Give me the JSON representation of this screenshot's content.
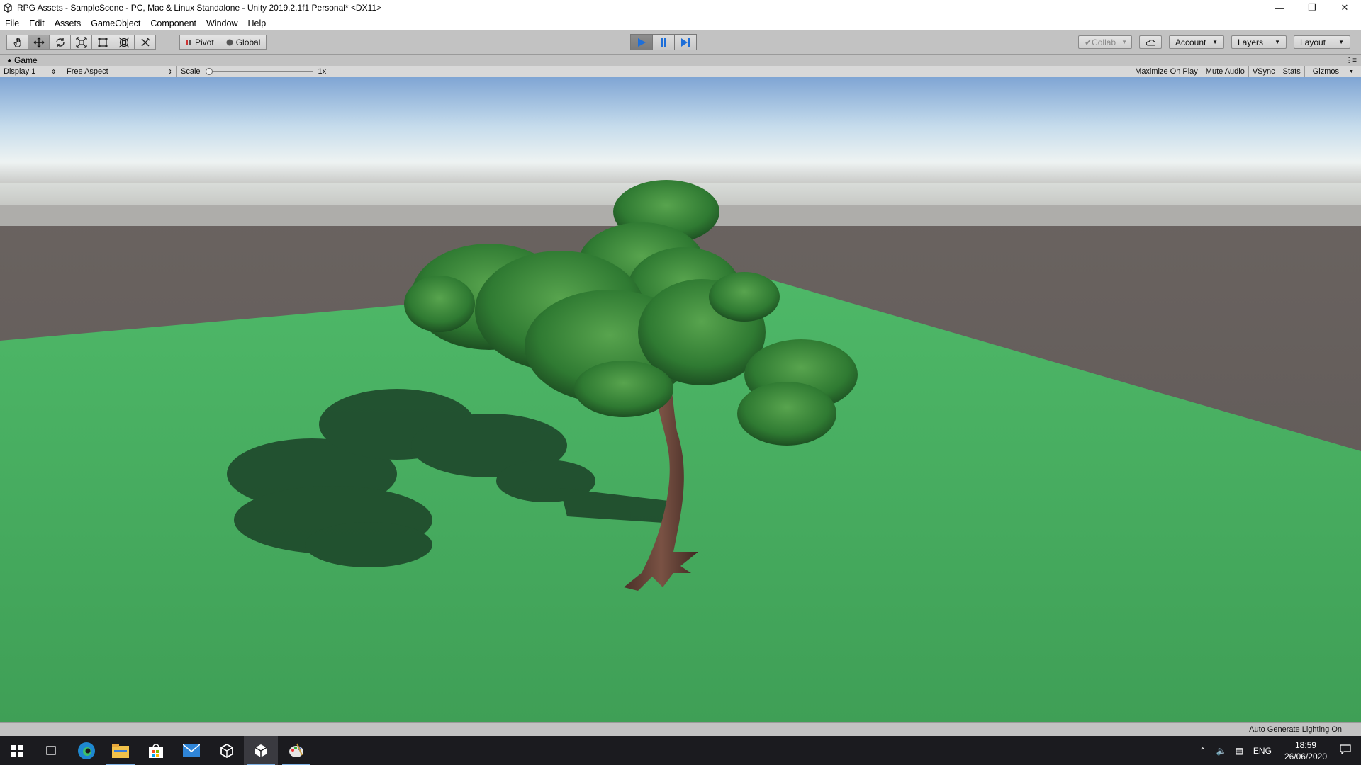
{
  "window": {
    "title": "RPG Assets - SampleScene - PC, Mac & Linux Standalone - Unity 2019.2.1f1 Personal* <DX11>",
    "minimize_icon": "minimize-icon",
    "restore_icon": "restore-icon",
    "close_icon": "close-icon"
  },
  "menu": {
    "items": [
      "File",
      "Edit",
      "Assets",
      "GameObject",
      "Component",
      "Window",
      "Help"
    ]
  },
  "toolbar": {
    "tools": [
      "hand-tool-icon",
      "move-tool-icon",
      "rotate-tool-icon",
      "scale-tool-icon",
      "rect-tool-icon",
      "transform-tool-icon",
      "custom-tool-icon"
    ],
    "active_tool": "move-tool-icon",
    "pivot_label": "Pivot",
    "global_label": "Global",
    "play_active": true,
    "collab_label": "Collab",
    "account_label": "Account",
    "layers_label": "Layers",
    "layout_label": "Layout",
    "accent_color": "#1f6fd8"
  },
  "game_view": {
    "tab_label": "Game",
    "display_label": "Display 1",
    "aspect_label": "Free Aspect",
    "scale_label": "Scale",
    "scale_value": "1x",
    "scale_slider_value": 0,
    "toggles": [
      "Maximize On Play",
      "Mute Audio",
      "VSync",
      "Stats",
      "Gizmos"
    ]
  },
  "status": {
    "text": "Auto Generate Lighting On"
  },
  "taskbar": {
    "apps": [
      "windows-start-icon",
      "task-view-icon",
      "edge-icon",
      "file-explorer-icon",
      "store-icon",
      "mail-icon",
      "unity-hub-icon",
      "unity-icon",
      "paint-icon"
    ],
    "language": "ENG",
    "time": "18:59",
    "date": "26/06/2020"
  }
}
